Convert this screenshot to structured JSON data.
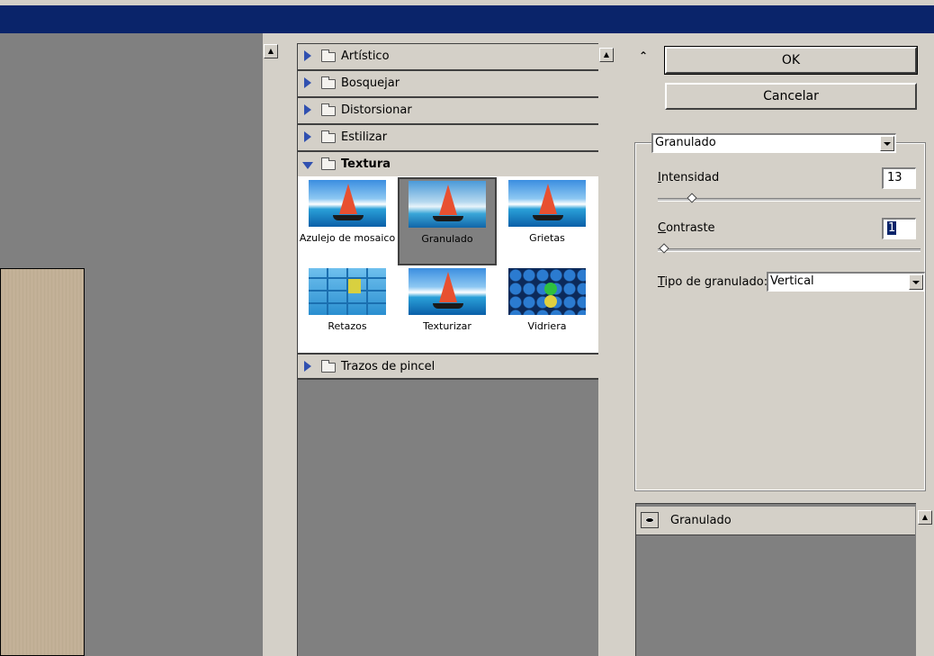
{
  "categories": [
    {
      "label": "Artístico",
      "expanded": false
    },
    {
      "label": "Bosquejar",
      "expanded": false
    },
    {
      "label": "Distorsionar",
      "expanded": false
    },
    {
      "label": "Estilizar",
      "expanded": false
    },
    {
      "label": "Textura",
      "expanded": true
    },
    {
      "label": "Trazos de pincel",
      "expanded": false
    }
  ],
  "textura_filters": [
    {
      "label": "Azulejo de mosaico",
      "icon": "boat-thumbnail"
    },
    {
      "label": "Granulado",
      "icon": "boat-thumbnail",
      "selected": true
    },
    {
      "label": "Grietas",
      "icon": "boat-thumbnail"
    },
    {
      "label": "Retazos",
      "icon": "tiles-thumbnail"
    },
    {
      "label": "Texturizar",
      "icon": "boat-thumbnail"
    },
    {
      "label": "Vidriera",
      "icon": "glass-thumbnail"
    }
  ],
  "buttons": {
    "ok": "OK",
    "cancel": "Cancelar"
  },
  "filter_select": {
    "value": "Granulado"
  },
  "params": {
    "intensity": {
      "label_prefix": "I",
      "label_rest": "ntensidad",
      "value": "13",
      "max": "100",
      "slider_fraction": 0.13
    },
    "contrast": {
      "label_prefix": "C",
      "label_rest": "ontraste",
      "value": "1",
      "max": "100",
      "slider_fraction": 0.01
    },
    "grain_type": {
      "label_prefix": "T",
      "label_rest": "ipo de granulado:",
      "value": "Vertical"
    }
  },
  "layers": [
    {
      "label": "Granulado",
      "visible": true
    }
  ],
  "colors": {
    "title_bar": "#0a246a",
    "panel": "#d4d0c8",
    "dark_panel": "#808080",
    "selection": "#0a246a"
  }
}
